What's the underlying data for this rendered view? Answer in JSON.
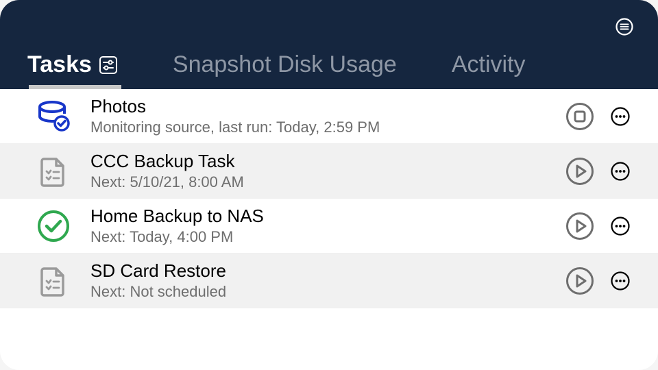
{
  "header": {
    "tabs": [
      {
        "label": "Tasks",
        "active": true
      },
      {
        "label": "Snapshot Disk Usage",
        "active": false
      },
      {
        "label": "Activity",
        "active": false
      }
    ]
  },
  "tasks": [
    {
      "icon": "db-check",
      "title": "Photos",
      "subtitle": "Monitoring source, last run: Today, 2:59 PM",
      "action": "stop",
      "alt": false
    },
    {
      "icon": "checklist",
      "title": "CCC Backup Task",
      "subtitle": "Next: 5/10/21, 8:00 AM",
      "action": "play",
      "alt": true
    },
    {
      "icon": "check-circle",
      "title": "Home Backup to NAS",
      "subtitle": "Next: Today, 4:00 PM",
      "action": "play",
      "alt": false
    },
    {
      "icon": "checklist",
      "title": "SD Card Restore",
      "subtitle": "Next: Not scheduled",
      "action": "play",
      "alt": true
    }
  ]
}
